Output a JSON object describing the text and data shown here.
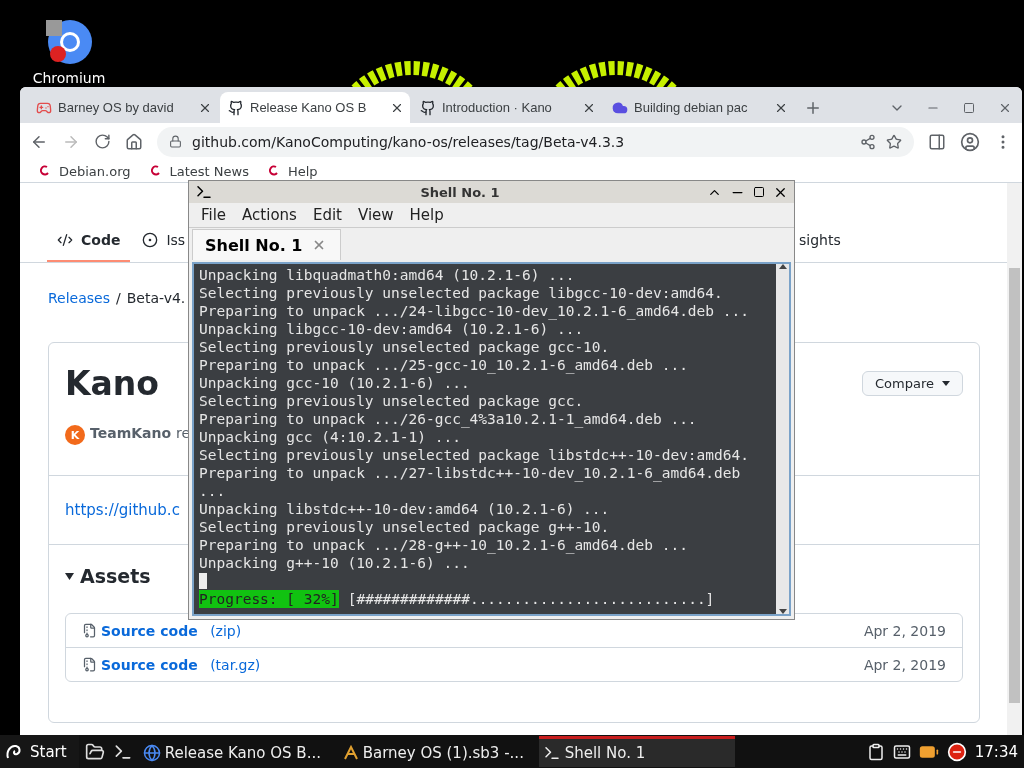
{
  "desktop": {
    "icons": [
      {
        "label": "Chromium"
      }
    ]
  },
  "browser": {
    "tabs": [
      {
        "title": "Barney OS by david",
        "selected": false,
        "kind": "game"
      },
      {
        "title": "Release Kano OS B",
        "selected": true,
        "kind": "github"
      },
      {
        "title": "Introduction · Kano",
        "selected": false,
        "kind": "github"
      },
      {
        "title": "Building debian pac",
        "selected": false,
        "kind": "cloud"
      }
    ],
    "address": "github.com/KanoComputing/kano-os/releases/tag/Beta-v4.3.3",
    "bookmarks": [
      {
        "label": "Debian.org"
      },
      {
        "label": "Latest News"
      },
      {
        "label": "Help"
      }
    ],
    "page": {
      "repo_nav": [
        {
          "label": "Code",
          "selected": true,
          "kind": "code"
        },
        {
          "label": "Iss",
          "selected": false,
          "kind": "issue"
        },
        {
          "label": "sights",
          "selected": false,
          "kind": "plain"
        }
      ],
      "breadcrumb": {
        "link": "Releases",
        "separator": "/",
        "current": "Beta-v4."
      },
      "release": {
        "title": "Kano",
        "compare": "Compare",
        "avatar": "K",
        "author": "TeamKano",
        "author_suffix": "re",
        "link": "https://github.c",
        "assets_heading": "Assets",
        "assets": [
          {
            "name": "Source code",
            "ext": "(zip)",
            "date": "Apr 2, 2019"
          },
          {
            "name": "Source code",
            "ext": "(tar.gz)",
            "date": "Apr 2, 2019"
          }
        ]
      }
    }
  },
  "terminal": {
    "title": "Shell No. 1",
    "menu": [
      "File",
      "Actions",
      "Edit",
      "View",
      "Help"
    ],
    "tabs": [
      {
        "label": "Shell No. 1",
        "selected": true
      }
    ],
    "lines": [
      "Unpacking libquadmath0:amd64 (10.2.1-6) ...",
      "Selecting previously unselected package libgcc-10-dev:amd64.",
      "Preparing to unpack .../24-libgcc-10-dev_10.2.1-6_amd64.deb ...",
      "Unpacking libgcc-10-dev:amd64 (10.2.1-6) ...",
      "Selecting previously unselected package gcc-10.",
      "Preparing to unpack .../25-gcc-10_10.2.1-6_amd64.deb ...",
      "Unpacking gcc-10 (10.2.1-6) ...",
      "Selecting previously unselected package gcc.",
      "Preparing to unpack .../26-gcc_4%3a10.2.1-1_amd64.deb ...",
      "Unpacking gcc (4:10.2.1-1) ...",
      "Selecting previously unselected package libstdc++-10-dev:amd64.",
      "Preparing to unpack .../27-libstdc++-10-dev_10.2.1-6_amd64.deb",
      "...",
      "Unpacking libstdc++-10-dev:amd64 (10.2.1-6) ...",
      "Selecting previously unselected package g++-10.",
      "Preparing to unpack .../28-g++-10_10.2.1-6_amd64.deb ...",
      "Unpacking g++-10 (10.2.1-6) ..."
    ],
    "progress": {
      "label": "Progress: [ 32%]",
      "bar": "[#############...........................]"
    }
  },
  "taskbar": {
    "start": "Start",
    "tasks": [
      {
        "label": "Release Kano OS B...",
        "selected": false,
        "kind": "browser"
      },
      {
        "label": "Barney OS (1).sb3 -...",
        "selected": false,
        "kind": "scratch"
      },
      {
        "label": "Shell No. 1",
        "selected": true,
        "kind": "terminal"
      }
    ],
    "clock": "17:34"
  }
}
